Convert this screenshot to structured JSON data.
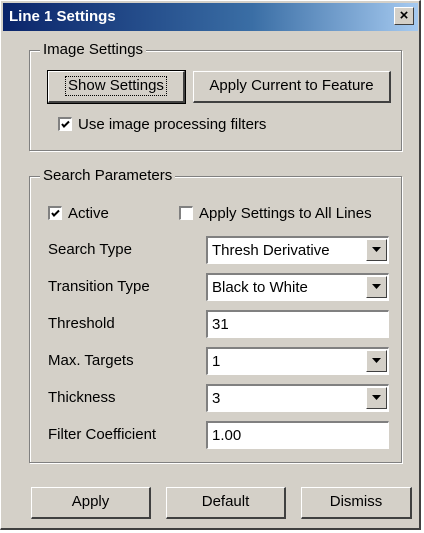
{
  "window": {
    "title": "Line 1 Settings",
    "close_glyph": "×"
  },
  "image_settings": {
    "legend": "Image Settings",
    "show_settings_label": "Show Settings",
    "apply_current_label": "Apply Current to Feature",
    "use_filters_label": "Use image processing filters",
    "use_filters_checked": true
  },
  "search_parameters": {
    "legend": "Search Parameters",
    "active_label": "Active",
    "active_checked": true,
    "apply_all_label": "Apply Settings to All Lines",
    "apply_all_checked": false,
    "search_type_label": "Search Type",
    "search_type_value": "Thresh Derivative",
    "transition_type_label": "Transition Type",
    "transition_type_value": "Black to White",
    "threshold_label": "Threshold",
    "threshold_value": "31",
    "max_targets_label": "Max. Targets",
    "max_targets_value": "1",
    "thickness_label": "Thickness",
    "thickness_value": "3",
    "filter_coefficient_label": "Filter Coefficient",
    "filter_coefficient_value": "1.00"
  },
  "footer": {
    "apply_label": "Apply",
    "default_label": "Default",
    "dismiss_label": "Dismiss"
  },
  "icons": {
    "checkmark": "check-icon",
    "dropdown": "chevron-down-icon",
    "close": "close-icon"
  }
}
